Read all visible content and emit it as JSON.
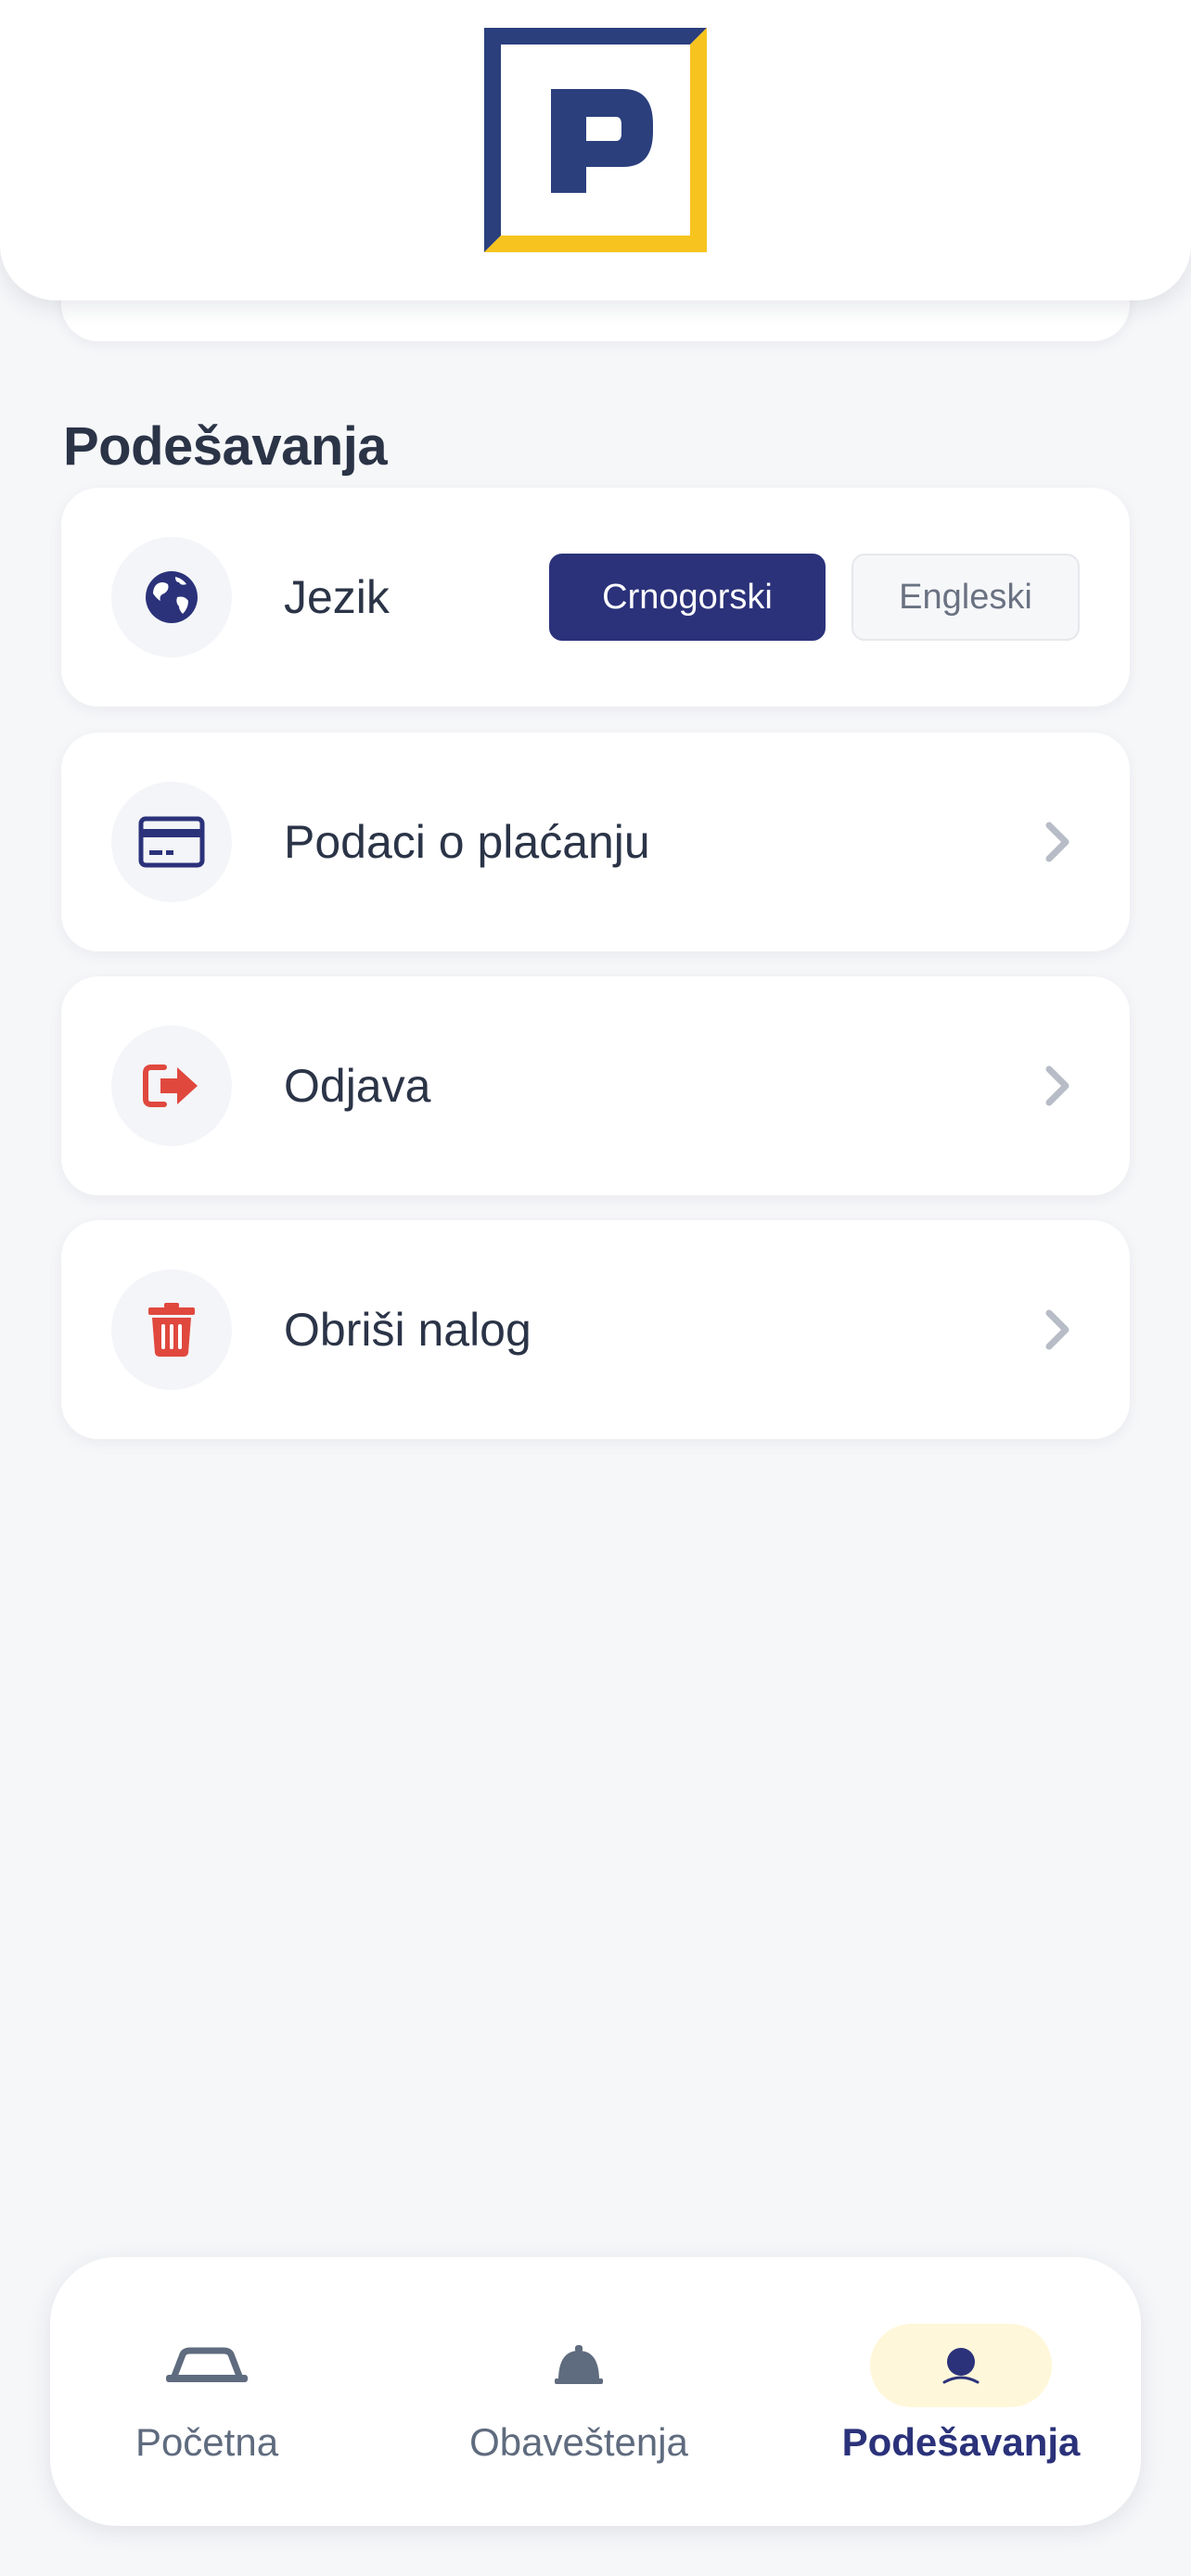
{
  "header": {
    "logo_letter": "P"
  },
  "settings": {
    "title": "Podešavanja",
    "language": {
      "label": "Jezik",
      "options": [
        "Crnogorski",
        "Engleski"
      ],
      "selected": "Crnogorski"
    },
    "items": [
      {
        "label": "Podaci o plaćanju",
        "icon": "credit-card-icon"
      },
      {
        "label": "Odjava",
        "icon": "logout-icon"
      },
      {
        "label": "Obriši nalog",
        "icon": "trash-icon"
      }
    ]
  },
  "bottom_nav": {
    "items": [
      {
        "label": "Početna",
        "icon": "car-icon"
      },
      {
        "label": "Obaveštenja",
        "icon": "bell-icon"
      },
      {
        "label": "Podešavanja",
        "icon": "user-icon",
        "active": true
      }
    ]
  },
  "colors": {
    "primary": "#2b327a",
    "accent_yellow": "#f7c41f",
    "danger": "#e0483e",
    "text": "#2b3447",
    "background": "#f6f7f9"
  }
}
